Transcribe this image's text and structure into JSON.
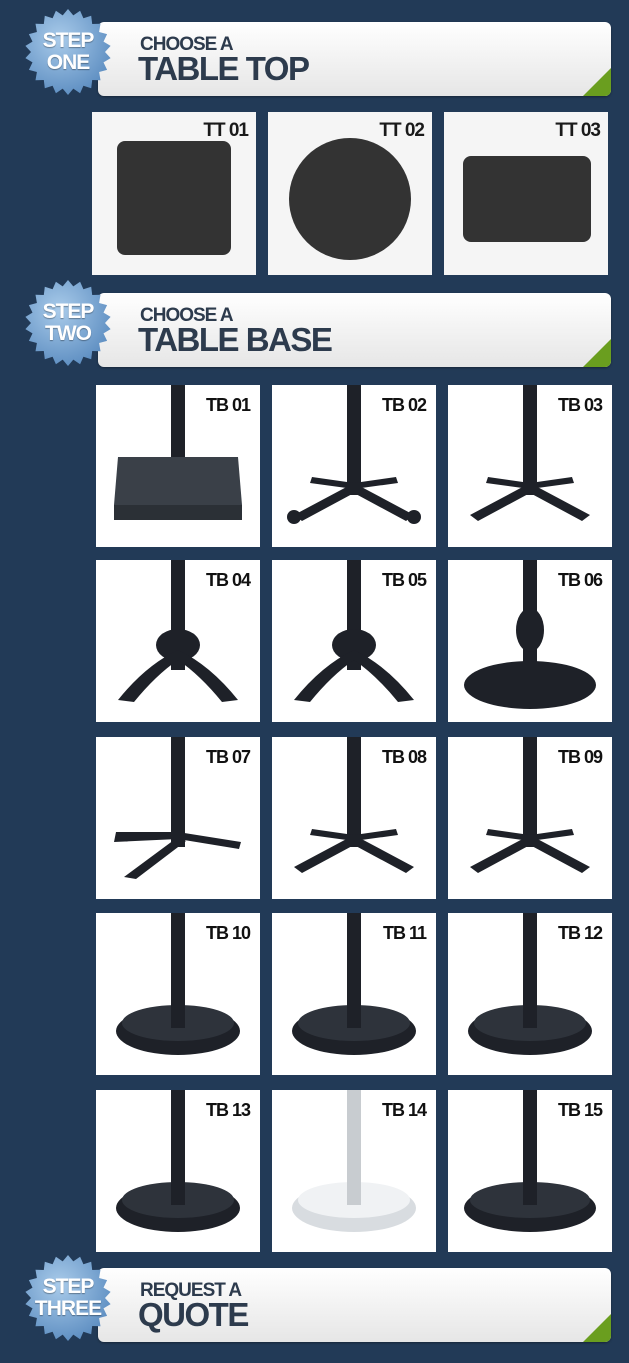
{
  "steps": [
    {
      "badge_line1": "STEP",
      "badge_line2": "ONE",
      "title_small": "CHOOSE A",
      "title_large": "TABLE TOP"
    },
    {
      "badge_line1": "STEP",
      "badge_line2": "TWO",
      "title_small": "CHOOSE A",
      "title_large": "TABLE BASE"
    },
    {
      "badge_line1": "STEP",
      "badge_line2": "THREE",
      "title_small": "REQUEST A",
      "title_large": "QUOTE"
    }
  ],
  "table_tops": [
    {
      "code": "TT 01",
      "shape": "square"
    },
    {
      "code": "TT 02",
      "shape": "round"
    },
    {
      "code": "TT 03",
      "shape": "rectangle"
    }
  ],
  "table_bases": [
    {
      "code": "TB 01",
      "style": "square-plate"
    },
    {
      "code": "TB 02",
      "style": "four-leg-ball-feet"
    },
    {
      "code": "TB 03",
      "style": "four-leg-curved-wide"
    },
    {
      "code": "TB 04",
      "style": "ornate-four-leg"
    },
    {
      "code": "TB 05",
      "style": "ornate-four-leg-slim"
    },
    {
      "code": "TB 06",
      "style": "ornate-round"
    },
    {
      "code": "TB 07",
      "style": "three-leg"
    },
    {
      "code": "TB 08",
      "style": "four-leg-cross"
    },
    {
      "code": "TB 09",
      "style": "four-leg-cross-feet"
    },
    {
      "code": "TB 10",
      "style": "round-domed"
    },
    {
      "code": "TB 11",
      "style": "round-ribbed"
    },
    {
      "code": "TB 12",
      "style": "round-dotted"
    },
    {
      "code": "TB 13",
      "style": "round-fluted"
    },
    {
      "code": "TB 14",
      "style": "round-chrome"
    },
    {
      "code": "TB 15",
      "style": "round-flat"
    }
  ],
  "colors": {
    "background": "#223a57",
    "badge": "#6d9ccc",
    "accent": "#6a9e1f",
    "title": "#2d3b4d",
    "product": "#333333"
  }
}
